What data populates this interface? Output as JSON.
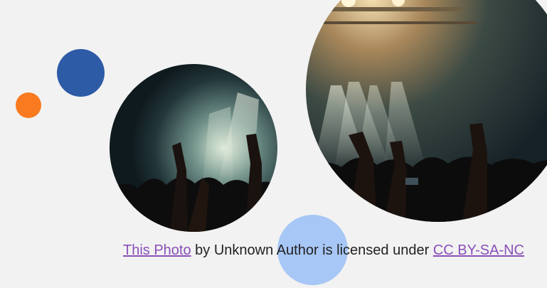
{
  "slide": {
    "colors": {
      "background": "#f2f2f2",
      "orange_dot": "#f97a1f",
      "navy_dot": "#2d5ba6",
      "light_blue_dot": "#a7c7f6",
      "link": "#8a4fb9"
    },
    "photos": [
      {
        "subject": "concert crowd with stage lights",
        "shape": "circle"
      },
      {
        "subject": "concert crowd with stage lights",
        "shape": "circle"
      }
    ],
    "caption": {
      "link1": "This Photo",
      "mid": " by Unknown Author is licensed under ",
      "link2": "CC BY-SA-NC"
    }
  }
}
